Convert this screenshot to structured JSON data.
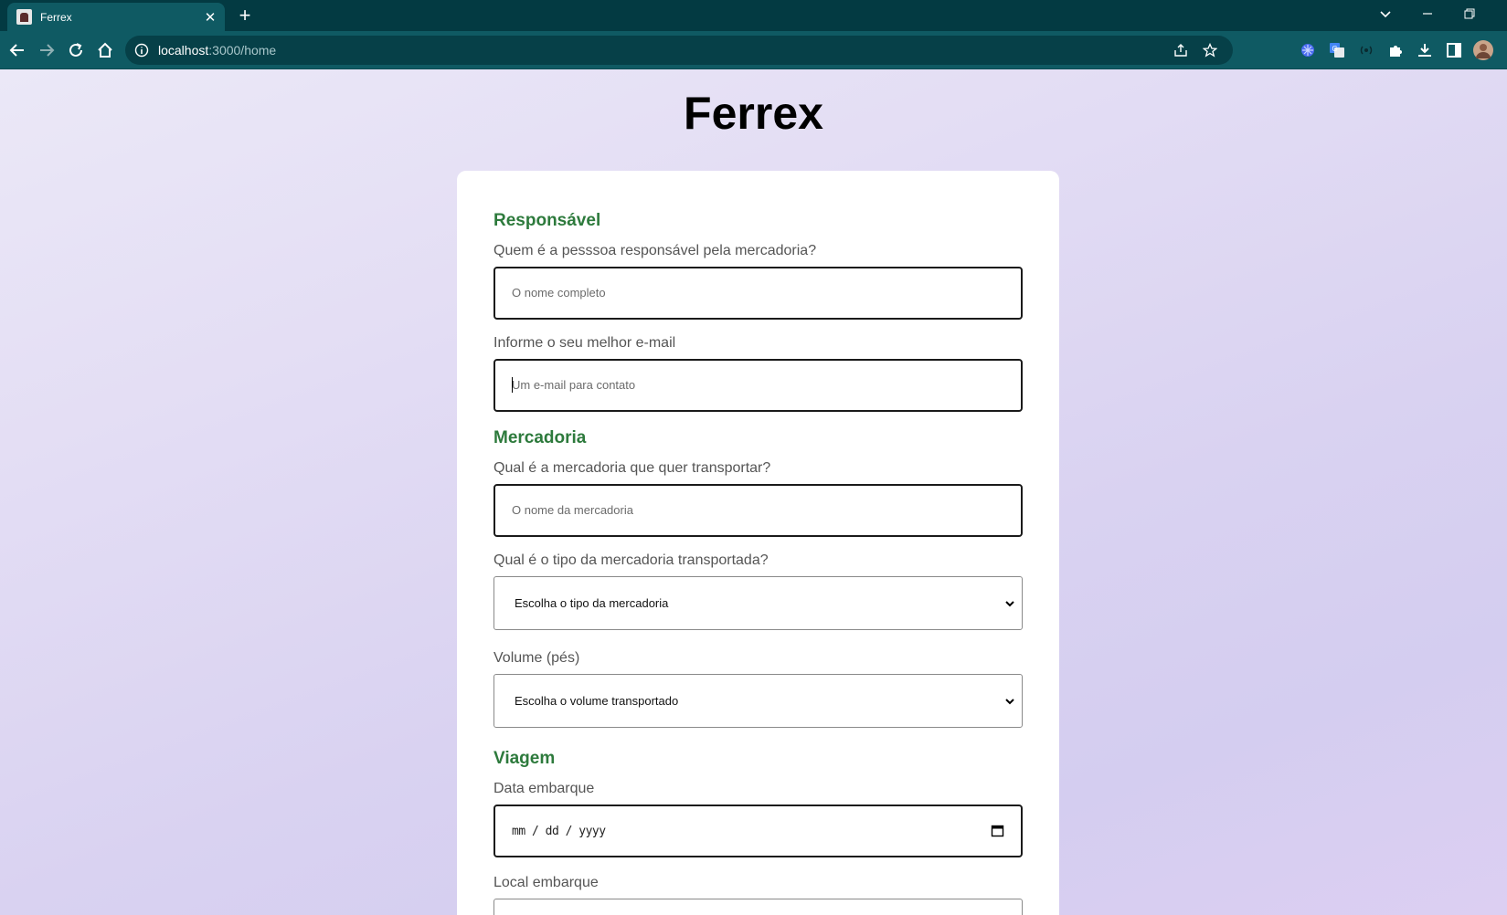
{
  "browser": {
    "tab_title": "Ferrex",
    "url_host": "localhost",
    "url_path": ":3000/home"
  },
  "page": {
    "brand": "Ferrex",
    "sections": {
      "responsavel": "Responsável",
      "mercadoria": "Mercadoria",
      "viagem": "Viagem"
    },
    "fields": {
      "nome": {
        "label": "Quem é a pesssoa responsável pela mercadoria?",
        "placeholder": "O nome completo"
      },
      "email": {
        "label": "Informe o seu melhor e-mail",
        "placeholder": "Um e-mail para contato"
      },
      "mercadoria": {
        "label": "Qual é a mercadoria que quer transportar?",
        "placeholder": "O nome da mercadoria"
      },
      "tipo": {
        "label": "Qual é o tipo da mercadoria transportada?",
        "value": "Escolha o tipo da mercadoria"
      },
      "volume": {
        "label": "Volume (pés)",
        "value": "Escolha o volume transportado"
      },
      "data": {
        "label": "Data embarque",
        "value": "mm / dd / yyyy"
      },
      "local": {
        "label": "Local embarque"
      }
    }
  },
  "colors": {
    "section_heading": "#2d7a3c",
    "chrome": "#0f5a63"
  }
}
